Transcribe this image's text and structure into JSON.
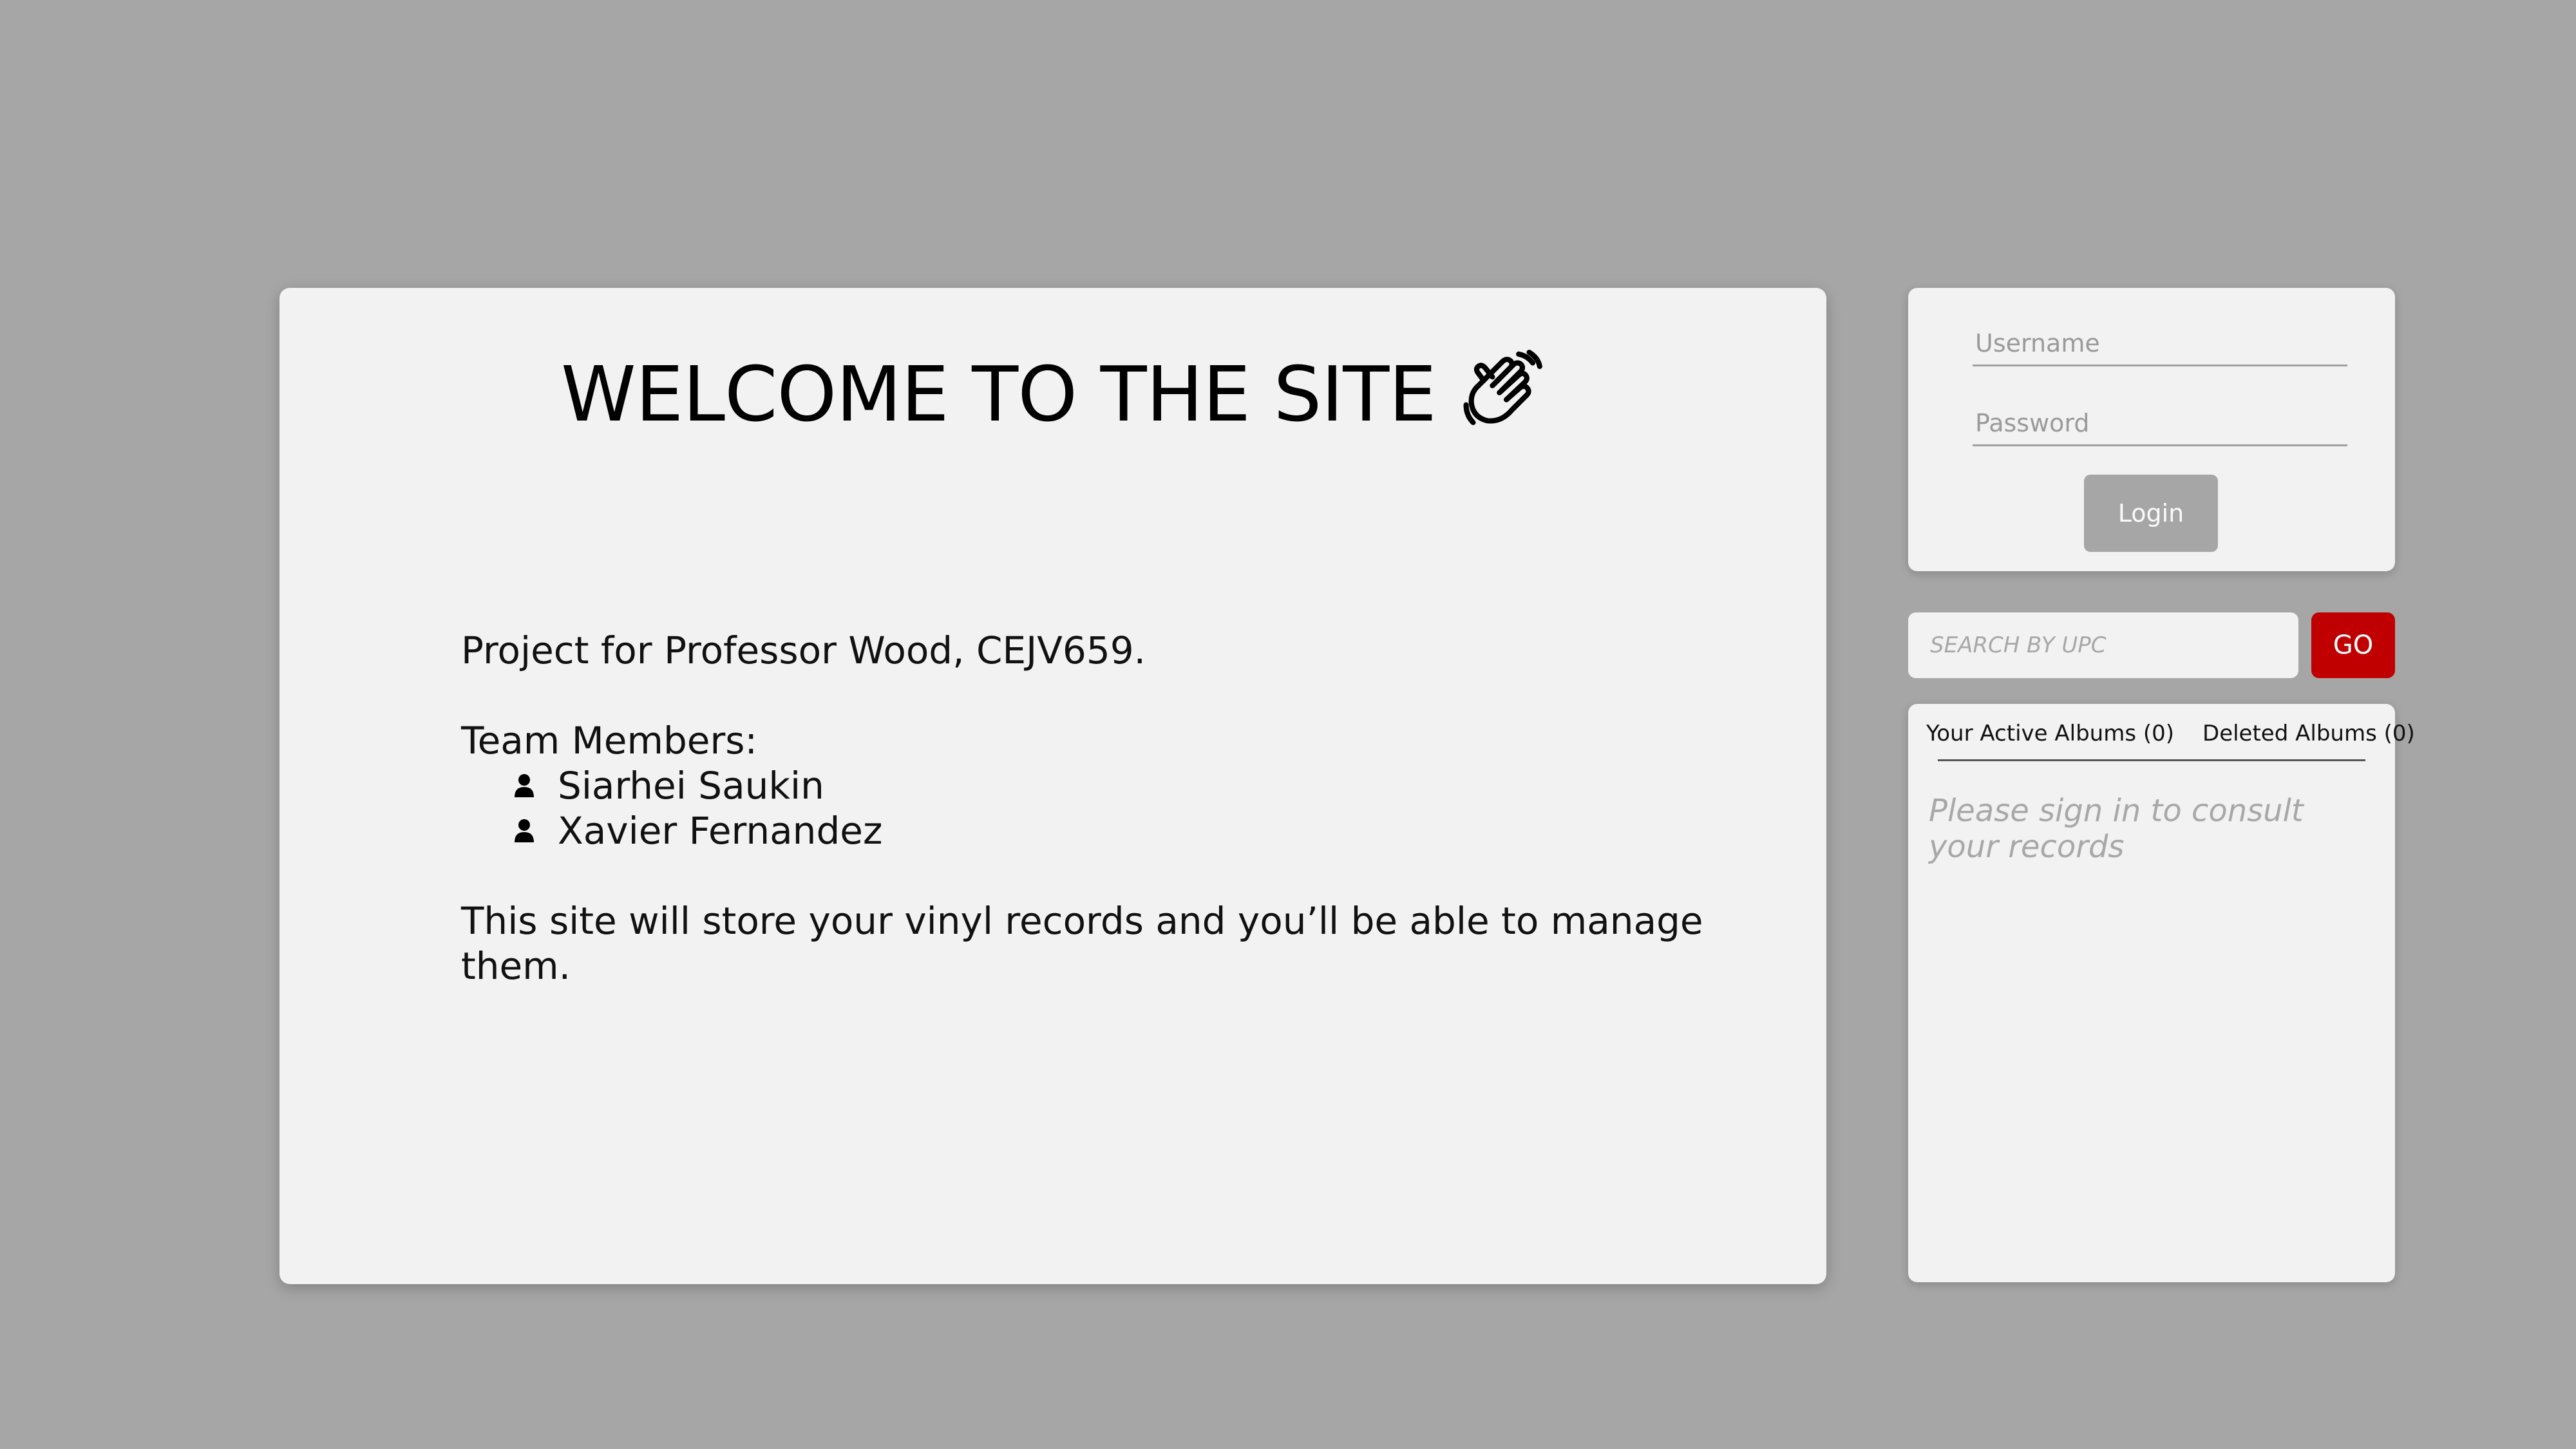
{
  "main": {
    "title": "WELCOME TO THE SITE",
    "title_icon": "waving-hand-icon",
    "project_line": "Project for Professor Wood, CEJV659.",
    "team_label": "Team Members:",
    "members": [
      {
        "name": "Siarhei Saukin",
        "icon": "person-icon"
      },
      {
        "name": "Xavier Fernandez",
        "icon": "person-icon"
      }
    ],
    "description": "This site will store your vinyl records and you’ll be able to manage them."
  },
  "login": {
    "username_placeholder": "Username",
    "password_placeholder": "Password",
    "button_label": "Login"
  },
  "search": {
    "placeholder": "SEARCH BY UPC",
    "button_label": "GO"
  },
  "albums": {
    "tabs": [
      {
        "label": "Your Active Albums (0)"
      },
      {
        "label": "Deleted Albums (0)"
      }
    ],
    "message": "Please sign in to consult your records"
  },
  "colors": {
    "background": "#a6a6a6",
    "card": "#f2f2f2",
    "accent": "#c00000",
    "disabled_button": "#a6a6a6"
  }
}
